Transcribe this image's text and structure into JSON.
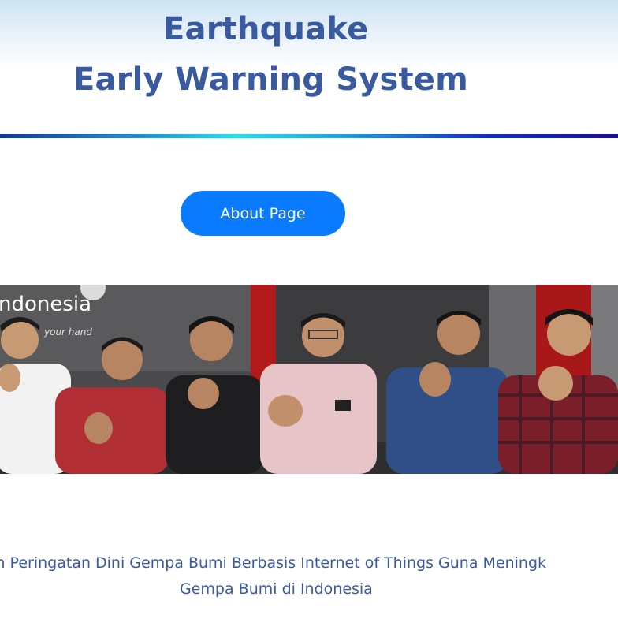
{
  "header": {
    "title_line1": "Earthquake",
    "title_line2": "Early Warning System"
  },
  "nav": {
    "about_label": "About Page"
  },
  "photo": {
    "sign_text": "ndonesia",
    "sign_sub": "your hand"
  },
  "description": {
    "line1": "m Peringatan Dini Gempa Bumi Berbasis Internet of Things Guna Meningk",
    "line2": "Gempa Bumi di Indonesia"
  },
  "colors": {
    "title": "#3a5aa0",
    "button": "#0a7bff",
    "divider_start": "#0b3b9a",
    "divider_mid": "#19e3ef",
    "divider_end": "#1a0f9a"
  }
}
